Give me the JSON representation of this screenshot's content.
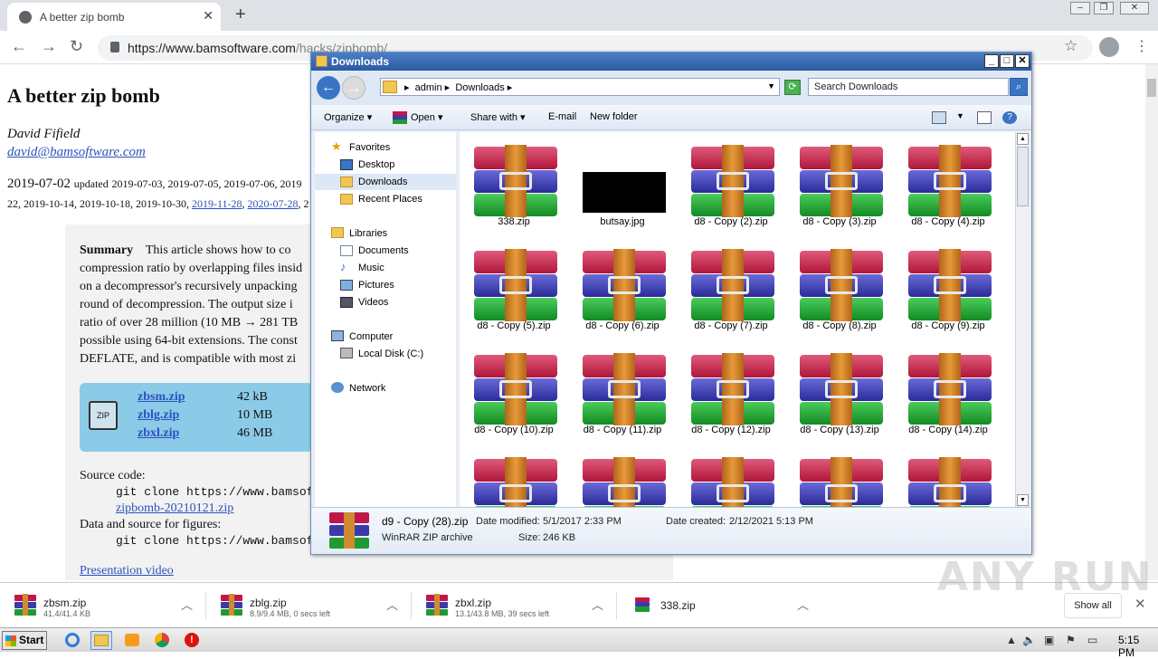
{
  "browser": {
    "tab_title": "A better zip bomb",
    "url_host": "https://www.bamsoftware.com",
    "url_path": "/hacks/zipbomb/"
  },
  "page": {
    "title": "A better zip bomb",
    "author": "David Fifield",
    "email": "david@bamsoftware.com",
    "date_main": "2019-07-02",
    "updated_prefix": "updated",
    "updated_dates_line1": "2019-07-03, 2019-07-05, 2019-07-06, 2019",
    "updated_dates_line2_plain": "22, 2019-10-14, 2019-10-18, 2019-10-30,",
    "updated_link1": "2019-11-28",
    "updated_link2": "2020-07-28",
    "updated_tail": ", 2",
    "summary_label": "Summary",
    "summary_lines": [
      "This article shows how to co",
      "compression ratio by overlapping files insid",
      "on a decompressor's recursively unpacking",
      "round of decompression. The output size i",
      "ratio of over 28 million (10 MB → 281 TB",
      "possible using 64-bit extensions. The const",
      "DEFLATE, and is compatible with most zi"
    ],
    "files": [
      {
        "name": "zbsm.zip",
        "size": "42 kB"
      },
      {
        "name": "zblg.zip",
        "size": "10 MB"
      },
      {
        "name": "zbxl.zip",
        "size": "46 MB"
      }
    ],
    "zip_icon_label": "ZIP",
    "source_label": "Source code:",
    "source_cmd": "git clone https://www.bamsoftwa",
    "source_archive": "zipbomb-20210121.zip",
    "data_label": "Data and source for figures:",
    "data_cmd": "git clone https://www.bamsoftwa",
    "presentation": "Presentation video"
  },
  "explorer": {
    "title": "Downloads",
    "breadcrumb": [
      "admin",
      "Downloads"
    ],
    "search_placeholder": "Search Downloads",
    "commands": [
      "Organize",
      "Open",
      "Share with",
      "E-mail",
      "New folder"
    ],
    "nav": {
      "favorites": "Favorites",
      "desktop": "Desktop",
      "downloads": "Downloads",
      "recent": "Recent Places",
      "libraries": "Libraries",
      "documents": "Documents",
      "music": "Music",
      "pictures": "Pictures",
      "videos": "Videos",
      "computer": "Computer",
      "localdisk": "Local Disk (C:)",
      "network": "Network"
    },
    "files": [
      "338.zip",
      "butsay.jpg",
      "d8 - Copy (2).zip",
      "d8 - Copy (3).zip",
      "d8 - Copy (4).zip",
      "d8 - Copy (5).zip",
      "d8 - Copy (6).zip",
      "d8 - Copy (7).zip",
      "d8 - Copy (8).zip",
      "d8 - Copy (9).zip",
      "d8 - Copy (10).zip",
      "d8 - Copy (11).zip",
      "d8 - Copy (12).zip",
      "d8 - Copy (13).zip",
      "d8 - Copy (14).zip"
    ],
    "details": {
      "name": "d9 - Copy (28).zip",
      "type": "WinRAR ZIP archive",
      "modified_label": "Date modified:",
      "modified": "5/1/2017 2:33 PM",
      "created_label": "Date created:",
      "created": "2/12/2021 5:13 PM",
      "size_label": "Size:",
      "size": "246 KB"
    }
  },
  "downloads_shelf": {
    "items": [
      {
        "name": "zbsm.zip",
        "status": "41.4/41.4 KB"
      },
      {
        "name": "zblg.zip",
        "status": "8.9/9.4 MB, 0 secs left"
      },
      {
        "name": "zbxl.zip",
        "status": "13.1/43.8 MB, 39 secs left"
      },
      {
        "name": "338.zip",
        "status": ""
      }
    ],
    "show_all": "Show all"
  },
  "watermark": "ANY RUN",
  "taskbar": {
    "start": "Start",
    "clock": "5:15 PM"
  }
}
